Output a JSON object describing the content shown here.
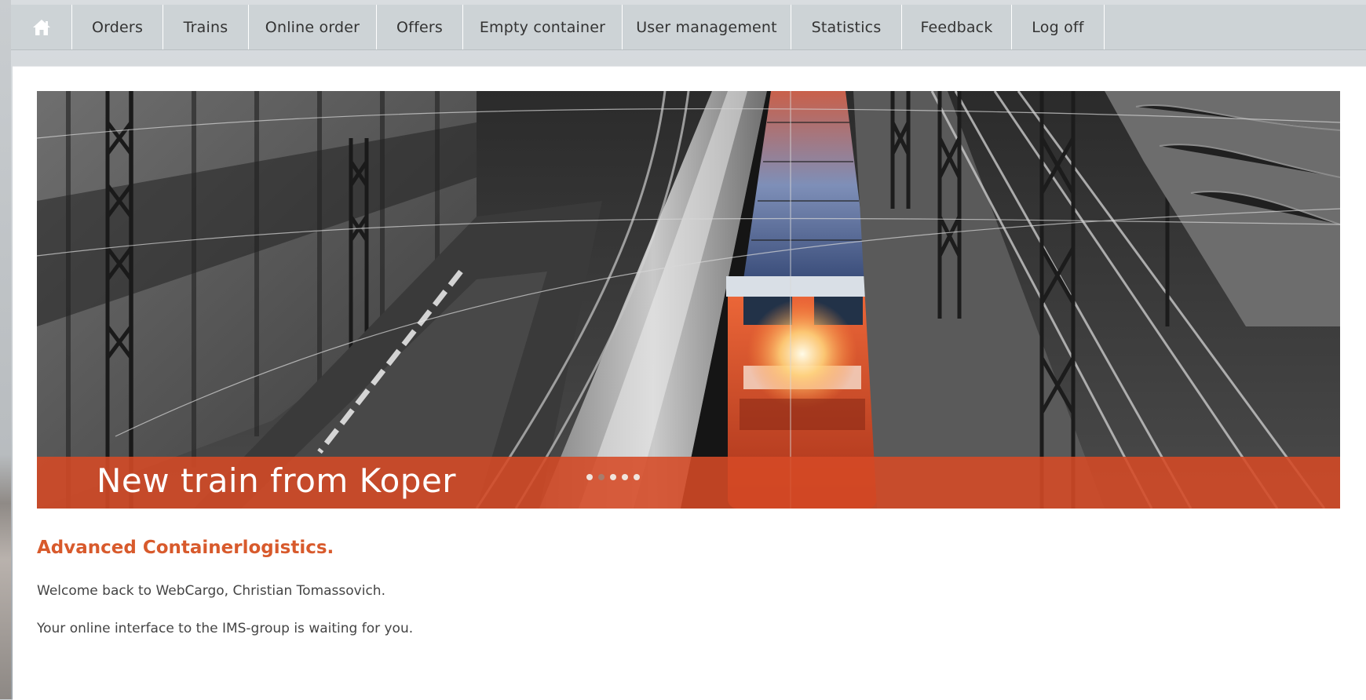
{
  "nav": {
    "home_icon": "home-icon",
    "items": [
      {
        "label": "Orders"
      },
      {
        "label": "Trains"
      },
      {
        "label": "Online order"
      },
      {
        "label": "Offers"
      },
      {
        "label": "Empty container"
      },
      {
        "label": "User management"
      },
      {
        "label": "Statistics"
      },
      {
        "label": "Feedback"
      },
      {
        "label": "Log off"
      }
    ]
  },
  "hero": {
    "caption": "New train from Koper",
    "slide_count": 5,
    "active_slide": 2
  },
  "main": {
    "headline": "Advanced Containerlogistics.",
    "welcome": "Welcome back to WebCargo, Christian Tomassovich.",
    "subtext": "Your online interface to the IMS-group is waiting for you."
  },
  "colors": {
    "accent": "#d85a2c",
    "caption_bar": "#d64a26",
    "nav_bg": "#cdd3d6"
  }
}
